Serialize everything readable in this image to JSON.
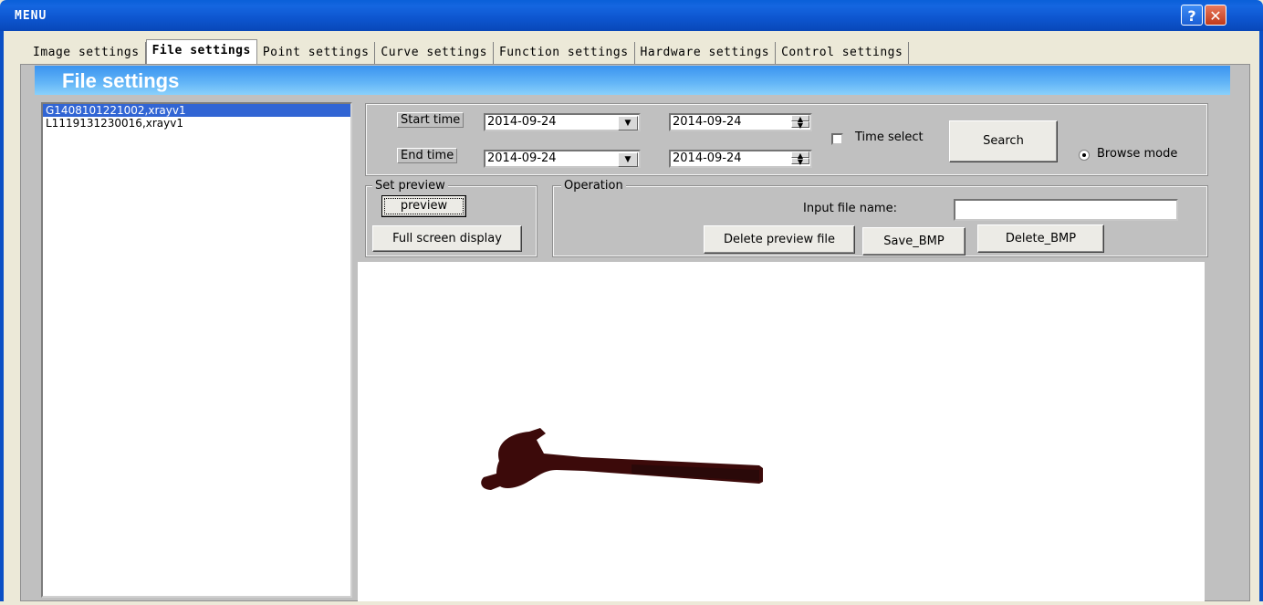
{
  "window": {
    "title": "MENU",
    "help_label": "?",
    "close_label": "✕"
  },
  "tabs": [
    {
      "label": "Image settings"
    },
    {
      "label": "File settings"
    },
    {
      "label": "Point settings"
    },
    {
      "label": "Curve settings"
    },
    {
      "label": "Function settings"
    },
    {
      "label": "Hardware settings"
    },
    {
      "label": "Control settings"
    }
  ],
  "banner": {
    "title": "File settings"
  },
  "files": [
    {
      "name": "G1408101221002,xrayv1"
    },
    {
      "name": "L1119131230016,xrayv1"
    }
  ],
  "search": {
    "start_label": "Start time",
    "end_label": "End time",
    "start_date": "2014-09-24",
    "start_time": "2014-09-24",
    "end_date": "2014-09-24",
    "end_time": "2014-09-24",
    "time_select_label": "Time select",
    "search_label": "Search",
    "browse_mode_label": "Browse mode"
  },
  "set_preview": {
    "title": "Set preview",
    "preview_label": "preview",
    "fullscreen_label": "Full screen display"
  },
  "operation": {
    "title": "Operation",
    "input_label": "Input file name:",
    "input_value": "",
    "delete_preview_label": "Delete preview file",
    "save_bmp_label": "Save_BMP",
    "delete_bmp_label": "Delete_BMP"
  },
  "colors": {
    "title_bar": "#0a5fd8",
    "banner": "#3a93f0",
    "selection": "#3165d4",
    "hammer": "#3c0a0a"
  }
}
